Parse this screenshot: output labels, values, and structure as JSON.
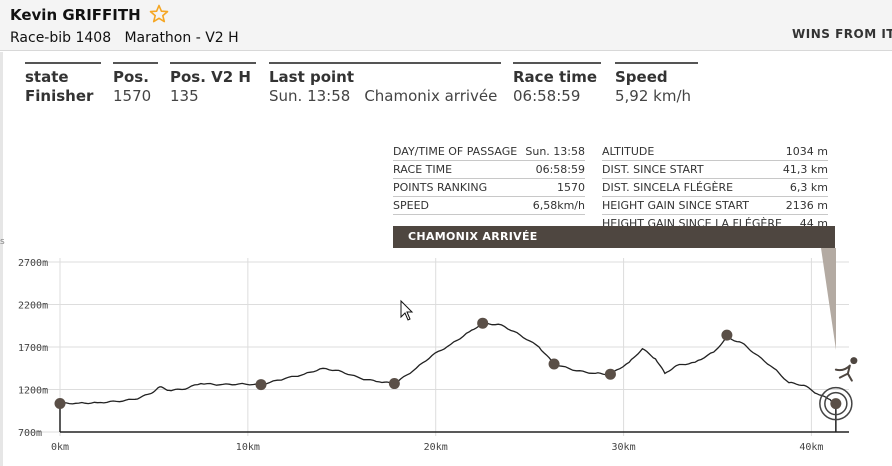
{
  "header": {
    "runner_name": "Kevin GRIFFITH",
    "bib_line": "Race-bib 1408   Marathon - V2 H",
    "promo_text": "WINS FROM IT"
  },
  "stats": [
    {
      "label": "state",
      "value": "Finisher"
    },
    {
      "label": "Pos.",
      "value": "1570"
    },
    {
      "label": "Pos. V2 H",
      "value": "135"
    },
    {
      "label": "Last point",
      "value": "Sun. 13:58",
      "value2": "Chamonix arrivée"
    },
    {
      "label": "Race time",
      "value": "06:58:59"
    },
    {
      "label": "Speed",
      "value": "5,92 km/h"
    }
  ],
  "point_info": {
    "left": [
      {
        "label": "DAY/TIME OF PASSAGE",
        "value": "Sun. 13:58"
      },
      {
        "label": "RACE TIME",
        "value": "06:58:59"
      },
      {
        "label": "POINTS RANKING",
        "value": "1570"
      },
      {
        "label": "SPEED",
        "value": "6,58km/h"
      }
    ],
    "right": [
      {
        "label": "ALTITUDE",
        "value": "1034 m"
      },
      {
        "label": "DIST. SINCE START",
        "value": "41,3 km"
      },
      {
        "label": "DIST. SINCELA FLÉGÈRE",
        "value": "6,3 km"
      },
      {
        "label": "HEIGHT GAIN SINCE START",
        "value": "2136 m"
      },
      {
        "label": "HEIGHT GAIN SINCE LA FLÉGÈRE",
        "value": "44 m"
      }
    ],
    "checkpoint_title": "CHAMONIX ARRIVÉE"
  },
  "colors": {
    "profile_line": "#222222",
    "checkpoint": "#5a4f47",
    "banner": "#4e4640",
    "grid": "#dddddd",
    "star": "#f5a623"
  },
  "chart_data": {
    "type": "line",
    "x_unit": "km",
    "y_unit": "m",
    "xlim": [
      0,
      42
    ],
    "ylim": [
      700,
      2700
    ],
    "x_ticks": [
      0,
      10,
      20,
      30,
      40
    ],
    "x_tick_labels": [
      "0km",
      "10km",
      "20km",
      "30km",
      "40km"
    ],
    "y_ticks": [
      700,
      1200,
      1700,
      2200,
      2700
    ],
    "y_tick_labels": [
      "700m",
      "1200m",
      "1700m",
      "2200m",
      "2700m"
    ],
    "grid": true,
    "profile": [
      [
        0,
        1035
      ],
      [
        1,
        1040
      ],
      [
        2,
        1045
      ],
      [
        3,
        1060
      ],
      [
        4,
        1085
      ],
      [
        4.8,
        1150
      ],
      [
        5.3,
        1230
      ],
      [
        5.8,
        1190
      ],
      [
        6.5,
        1200
      ],
      [
        7.5,
        1270
      ],
      [
        8.5,
        1255
      ],
      [
        9.5,
        1265
      ],
      [
        10.7,
        1258
      ],
      [
        12,
        1330
      ],
      [
        13,
        1380
      ],
      [
        14,
        1450
      ],
      [
        15,
        1410
      ],
      [
        16,
        1330
      ],
      [
        17,
        1290
      ],
      [
        17.8,
        1270
      ],
      [
        18.8,
        1420
      ],
      [
        19.8,
        1600
      ],
      [
        20.8,
        1730
      ],
      [
        21.8,
        1880
      ],
      [
        22.5,
        1980
      ],
      [
        23.5,
        1960
      ],
      [
        24.5,
        1840
      ],
      [
        25.5,
        1700
      ],
      [
        26.3,
        1500
      ],
      [
        27.5,
        1420
      ],
      [
        28.5,
        1390
      ],
      [
        29.3,
        1380
      ],
      [
        30.3,
        1520
      ],
      [
        31,
        1680
      ],
      [
        31.7,
        1560
      ],
      [
        32.2,
        1390
      ],
      [
        32.8,
        1480
      ],
      [
        33.8,
        1520
      ],
      [
        34.8,
        1640
      ],
      [
        35.5,
        1810
      ],
      [
        36.3,
        1750
      ],
      [
        37,
        1620
      ],
      [
        38,
        1450
      ],
      [
        38.8,
        1280
      ],
      [
        39.6,
        1250
      ],
      [
        40.3,
        1150
      ],
      [
        41,
        1080
      ],
      [
        41.3,
        1034
      ]
    ],
    "checkpoints": [
      {
        "x": 0,
        "y": 1035
      },
      {
        "x": 10.7,
        "y": 1258
      },
      {
        "x": 17.8,
        "y": 1270
      },
      {
        "x": 22.5,
        "y": 1980
      },
      {
        "x": 26.3,
        "y": 1500
      },
      {
        "x": 29.3,
        "y": 1380
      },
      {
        "x": 35.5,
        "y": 1840
      },
      {
        "x": 41.3,
        "y": 1034
      }
    ],
    "selected_index": 7
  }
}
